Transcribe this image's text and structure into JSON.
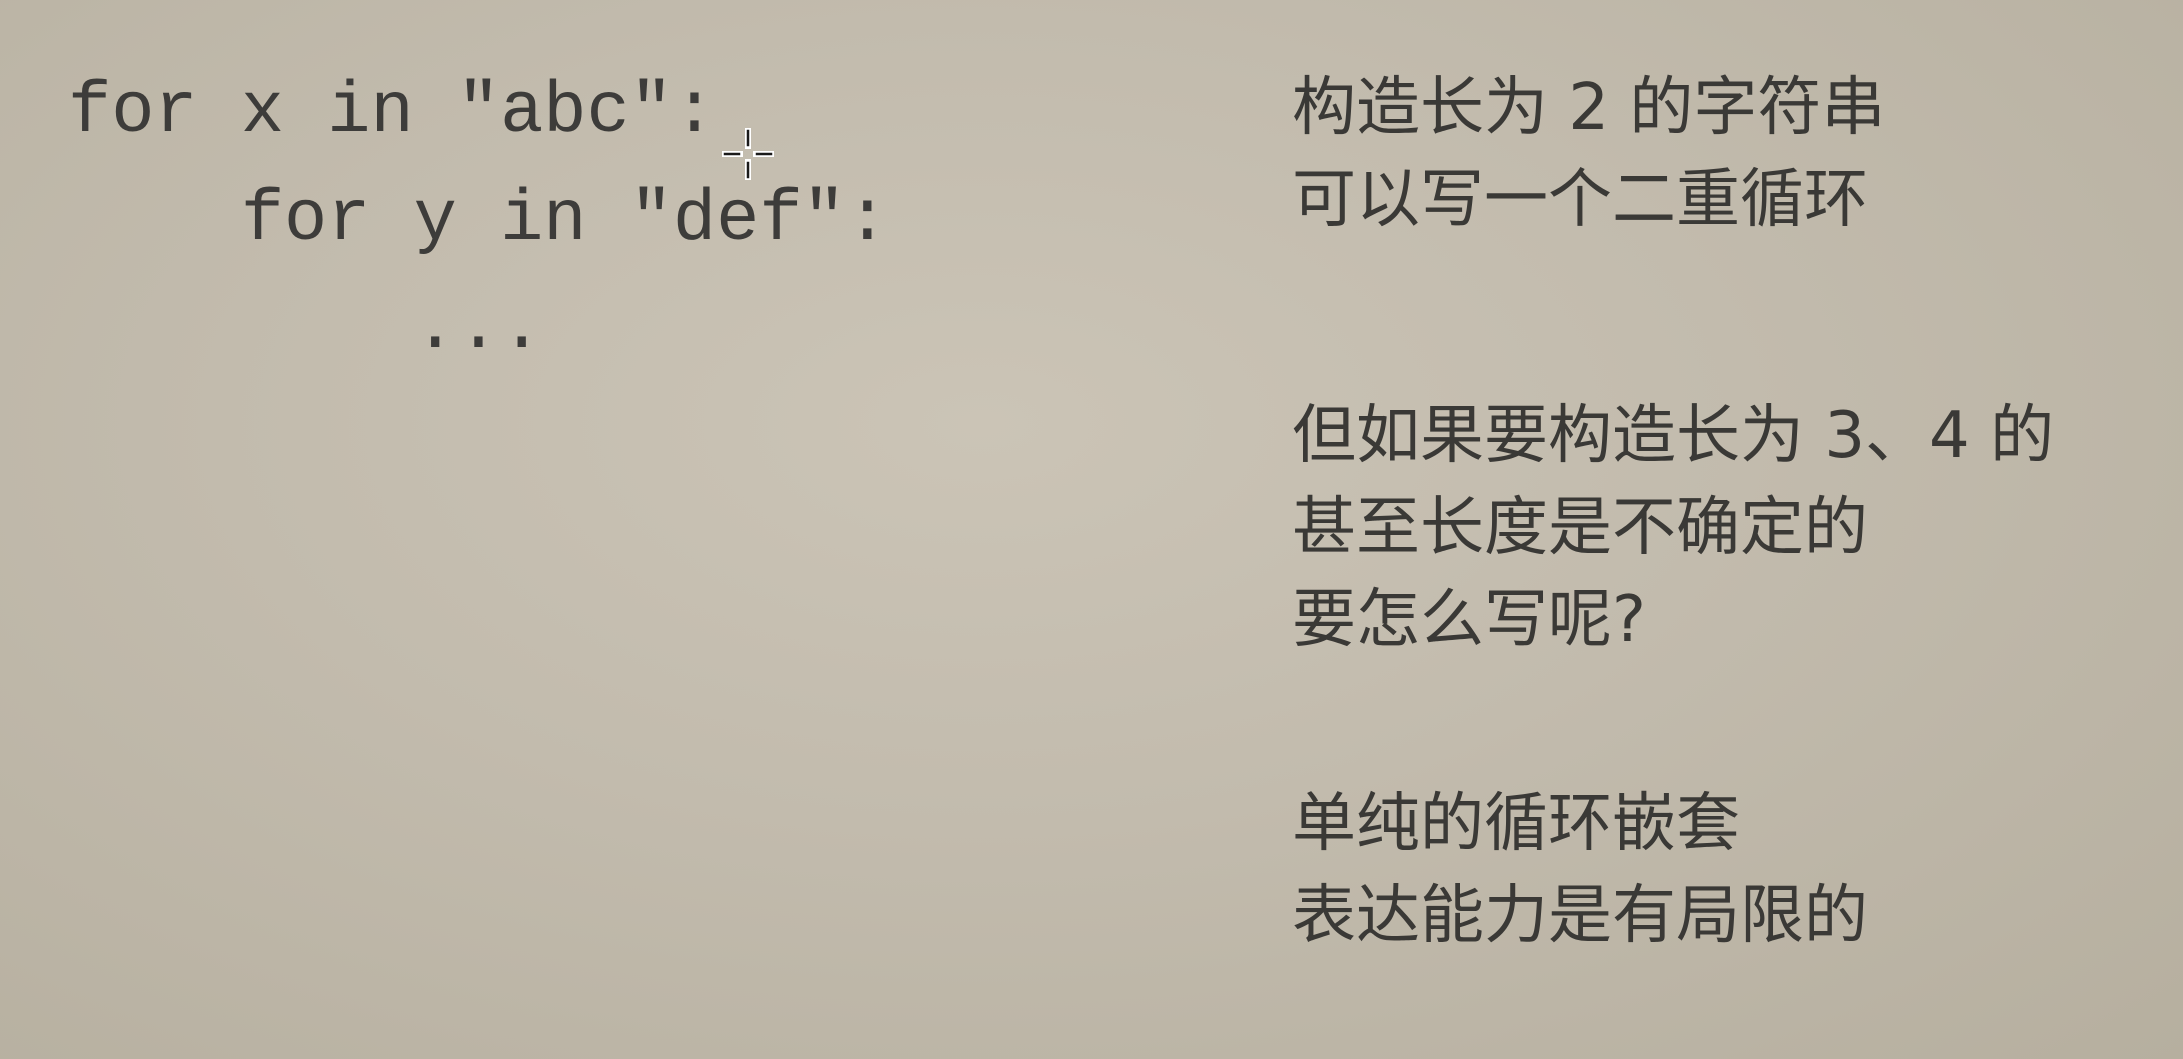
{
  "code": {
    "lines": [
      "for x in \"abc\":",
      "    for y in \"def\":",
      "        ..."
    ]
  },
  "notes": [
    {
      "lines": [
        "构造长为 2 的字符串",
        "可以写一个二重循环"
      ]
    },
    {
      "lines": [
        "但如果要构造长为 3、4 的",
        "甚至长度是不确定的",
        "要怎么写呢?"
      ]
    },
    {
      "lines": [
        "单纯的循环嵌套",
        "表达能力是有局限的"
      ]
    }
  ],
  "cursor": {
    "icon": "crosshair-cursor-icon"
  }
}
